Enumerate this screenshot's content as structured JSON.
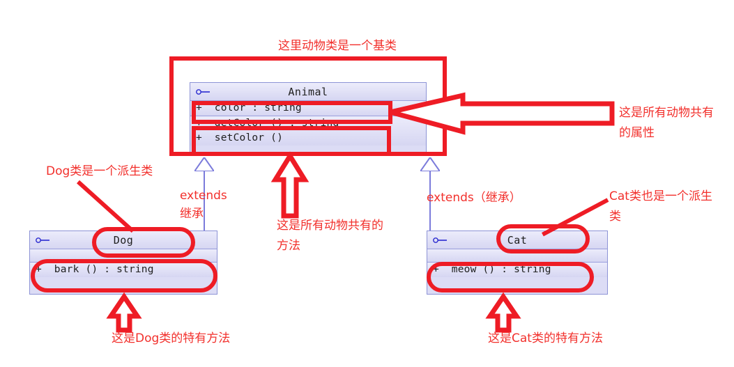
{
  "diagram": {
    "type": "uml-class-diagram",
    "colors": {
      "annotation_red": "#ee1c25",
      "class_border": "#8d93d6",
      "class_fill": "#dcdcf5",
      "connector_blue": "#7b7bdb"
    }
  },
  "classes": {
    "animal": {
      "name": "Animal",
      "attributes": [
        "+  color : string"
      ],
      "operations": [
        "+  getColor () : string",
        "+  setColor ()"
      ]
    },
    "dog": {
      "name": "Dog",
      "attributes": [],
      "operations": [
        "+  bark () : string"
      ]
    },
    "cat": {
      "name": "Cat",
      "attributes": [],
      "operations": [
        "+  meow () : string"
      ]
    }
  },
  "relations": {
    "dog_extends": "extends\n继承",
    "cat_extends": "extends（继承）"
  },
  "annotations": {
    "base_class": "这里动物类是一个基类",
    "shared_attribute": "这是所有动物共有\n的属性",
    "shared_method": "这是所有动物共有的\n方法",
    "dog_derived": "Dog类是一个派生类",
    "cat_derived": "Cat类也是一个派生\n类",
    "dog_specific_method": "这是Dog类的特有方法",
    "cat_specific_method": "这是Cat类的特有方法"
  }
}
